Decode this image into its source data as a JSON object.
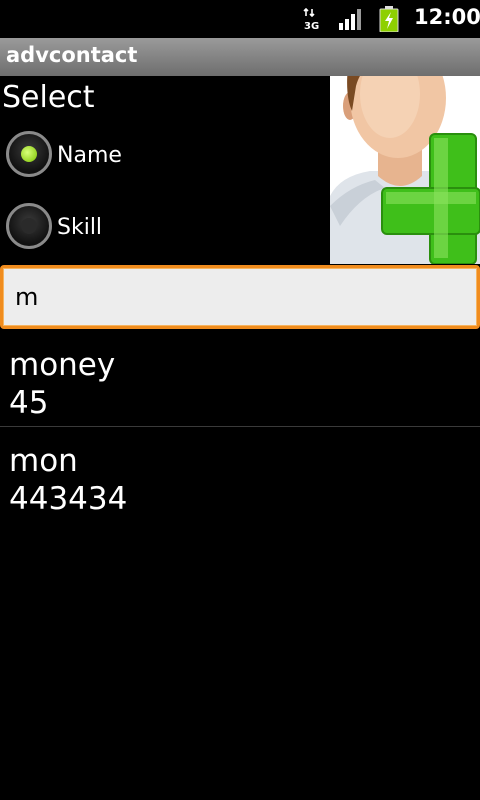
{
  "status_bar": {
    "network_icon": "3g-network-icon",
    "signal_icon": "signal-strength-icon",
    "battery_icon": "battery-charging-icon",
    "time": "12:00",
    "network_label": "3G"
  },
  "app": {
    "title": "advcontact"
  },
  "filter": {
    "label": "Select",
    "options": [
      {
        "label": "Name",
        "checked": true
      },
      {
        "label": "Skill",
        "checked": false
      }
    ]
  },
  "add_contact_icon": "add-contact-icon",
  "search": {
    "value": "m"
  },
  "results": [
    {
      "name": "money",
      "value": "45"
    },
    {
      "name": "mon",
      "value": "443434"
    }
  ],
  "colors": {
    "focus_border": "#f08c1e",
    "radio_checked": "#7cc200",
    "plus_green": "#3fbf1a"
  }
}
